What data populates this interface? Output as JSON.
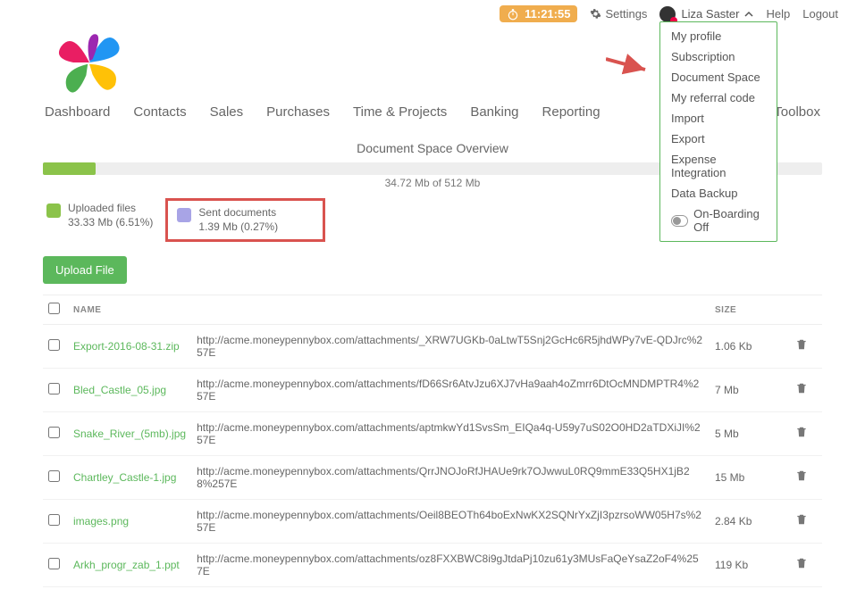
{
  "top": {
    "timer": "11:21:55",
    "settings": "Settings",
    "user_name": "Liza Saster",
    "help": "Help",
    "logout": "Logout"
  },
  "user_menu": {
    "items": [
      "My profile",
      "Subscription",
      "Document Space",
      "My referral code",
      "Import",
      "Export",
      "Expense Integration",
      "Data Backup"
    ],
    "onboarding": "On-Boarding Off"
  },
  "nav": [
    "Dashboard",
    "Contacts",
    "Sales",
    "Purchases",
    "Time & Projects",
    "Banking",
    "Reporting",
    "ck Toolbox"
  ],
  "overview": {
    "title": "Document Space Overview",
    "usage_text": "34.72 Mb of 512 Mb",
    "uploaded": {
      "label": "Uploaded files",
      "value": "33.33 Mb (6.51%)"
    },
    "sent": {
      "label": "Sent documents",
      "value": "1.39 Mb (0.27%)"
    }
  },
  "upload_btn": "Upload File",
  "columns": {
    "name": "NAME",
    "size": "SIZE"
  },
  "rows": [
    {
      "name": "Export-2016-08-31.zip",
      "url": "http://acme.moneypennybox.com/attachments/_XRW7UGKb-0aLtwT5Snj2GcHc6R5jhdWPy7vE-QDJrc%257E",
      "size": "1.06 Kb"
    },
    {
      "name": "Bled_Castle_05.jpg",
      "url": "http://acme.moneypennybox.com/attachments/fD66Sr6AtvJzu6XJ7vHa9aah4oZmrr6DtOcMNDMPTR4%257E",
      "size": "7 Mb"
    },
    {
      "name": "Snake_River_(5mb).jpg",
      "url": "http://acme.moneypennybox.com/attachments/aptmkwYd1SvsSm_EIQa4q-U59y7uS02O0HD2aTDXiJI%257E",
      "size": "5 Mb"
    },
    {
      "name": "Chartley_Castle-1.jpg",
      "url": "http://acme.moneypennybox.com/attachments/QrrJNOJoRfJHAUe9rk7OJwwuL0RQ9mmE33Q5HX1jB28%257E",
      "size": "15 Mb"
    },
    {
      "name": "images.png",
      "url": "http://acme.moneypennybox.com/attachments/Oeil8BEOTh64boExNwKX2SQNrYxZjI3pzrsoWW05H7s%257E",
      "size": "2.84 Kb"
    },
    {
      "name": "Arkh_progr_zab_1.ppt",
      "url": "http://acme.moneypennybox.com/attachments/oz8FXXBWC8i9gJtdaPj10zu61y3MUsFaQeYsaZ2oF4%257E",
      "size": "119 Kb"
    }
  ]
}
